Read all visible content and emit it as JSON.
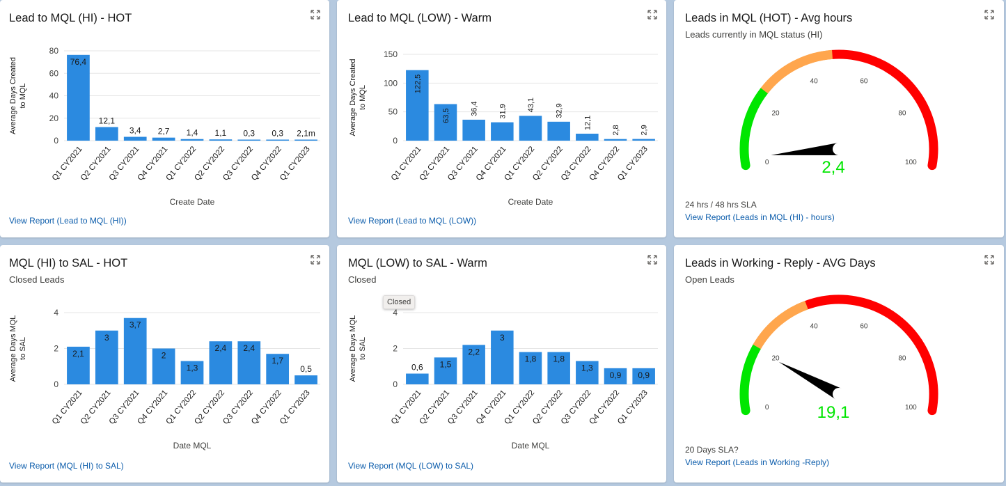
{
  "cards": {
    "c1": {
      "title": "Lead to MQL (HI) - HOT",
      "link": "View Report (Lead to MQL (HI))",
      "chart_data": {
        "type": "bar",
        "categories": [
          "Q1 CY2021",
          "Q2 CY2021",
          "Q3 CY2021",
          "Q4 CY2021",
          "Q1 CY2022",
          "Q2 CY2022",
          "Q3 CY2022",
          "Q4 CY2022",
          "Q1 CY2023"
        ],
        "values": [
          76.4,
          12.1,
          3.4,
          2.7,
          1.4,
          1.1,
          0.3,
          0.3,
          0.00146
        ],
        "labels": [
          "76,4",
          "12,1",
          "3,4",
          "2,7",
          "1,4",
          "1,1",
          "0,3",
          "0,3",
          "2,1m"
        ],
        "ylabel": "Average Days Created to MQL",
        "xlabel": "Create Date",
        "ylim": [
          0,
          80
        ],
        "yticks": [
          0,
          20,
          40,
          60,
          80
        ],
        "label_orientation": "horizontal"
      }
    },
    "c2": {
      "title": "Lead to MQL (LOW) - Warm",
      "link": "View Report (Lead to MQL (LOW))",
      "chart_data": {
        "type": "bar",
        "categories": [
          "Q1 CY2021",
          "Q2 CY2021",
          "Q3 CY2021",
          "Q4 CY2021",
          "Q1 CY2022",
          "Q2 CY2022",
          "Q3 CY2022",
          "Q4 CY2022",
          "Q1 CY2023"
        ],
        "values": [
          122.5,
          63.5,
          36.4,
          31.9,
          43.1,
          32.9,
          12.1,
          2.8,
          2.9
        ],
        "labels": [
          "122,5",
          "63,5",
          "36,4",
          "31,9",
          "43,1",
          "32,9",
          "12,1",
          "2,8",
          "2,9"
        ],
        "ylabel": "Average Days Created to MQL",
        "xlabel": "Create Date",
        "ylim": [
          0,
          150
        ],
        "yticks": [
          0,
          50,
          100,
          150
        ],
        "label_orientation": "vertical"
      }
    },
    "c3": {
      "title": "Leads in MQL (HOT) - Avg hours",
      "subtitle": "Leads currently in MQL status (HI)",
      "sla": "24 hrs / 48 hrs SLA",
      "link": "View Report (Leads in MQL (HI) - hours)",
      "gauge": {
        "min": 0,
        "max": 100,
        "value": 2.4,
        "value_label": "2,4",
        "ticks": [
          0,
          20,
          40,
          60,
          80,
          100
        ],
        "bands": [
          {
            "from": 0,
            "to": 24,
            "color": "#00e600"
          },
          {
            "from": 24,
            "to": 48,
            "color": "#ffa64d"
          },
          {
            "from": 48,
            "to": 100,
            "color": "#ff0000"
          }
        ]
      }
    },
    "c4": {
      "title": "MQL (HI) to SAL - HOT",
      "subtitle": "Closed Leads",
      "link": "View Report (MQL (HI) to SAL)",
      "chart_data": {
        "type": "bar",
        "categories": [
          "Q1 CY2021",
          "Q2 CY2021",
          "Q3 CY2021",
          "Q4 CY2021",
          "Q1 CY2022",
          "Q2 CY2022",
          "Q3 CY2022",
          "Q4 CY2022",
          "Q1 CY2023"
        ],
        "values": [
          2.1,
          3,
          3.7,
          2,
          1.3,
          2.4,
          2.4,
          1.7,
          0.5
        ],
        "labels": [
          "2,1",
          "3",
          "3,7",
          "2",
          "1,3",
          "2,4",
          "2,4",
          "1,7",
          "0,5"
        ],
        "ylabel": "Average Days MQL to SAL",
        "xlabel": "Date MQL",
        "ylim": [
          0,
          4
        ],
        "yticks": [
          0,
          2,
          4
        ],
        "label_orientation": "horizontal"
      }
    },
    "c5": {
      "title": "MQL (LOW) to SAL - Warm",
      "subtitle": "Closed",
      "tooltip": "Closed",
      "link": "View Report (MQL (LOW) to SAL)",
      "chart_data": {
        "type": "bar",
        "categories": [
          "Q1 CY2021",
          "Q2 CY2021",
          "Q3 CY2021",
          "Q4 CY2021",
          "Q1 CY2022",
          "Q2 CY2022",
          "Q3 CY2022",
          "Q4 CY2022",
          "Q1 CY2023"
        ],
        "values": [
          0.6,
          1.5,
          2.2,
          3,
          1.8,
          1.8,
          1.3,
          0.9,
          0.9
        ],
        "labels": [
          "0,6",
          "1,5",
          "2,2",
          "3",
          "1,8",
          "1,8",
          "1,3",
          "0,9",
          "0,9"
        ],
        "ylabel": "Average Days MQL to SAL",
        "xlabel": "Date MQL",
        "ylim": [
          0,
          4
        ],
        "yticks": [
          0,
          2,
          4
        ],
        "label_orientation": "horizontal"
      }
    },
    "c6": {
      "title": "Leads in Working - Reply - AVG Days",
      "subtitle": "Open Leads",
      "sla": "20 Days SLA?",
      "link": "View Report (Leads in Working -Reply)",
      "gauge": {
        "min": 0,
        "max": 100,
        "value": 19.1,
        "value_label": "19,1",
        "ticks": [
          0,
          20,
          40,
          60,
          80,
          100
        ],
        "bands": [
          {
            "from": 0,
            "to": 20,
            "color": "#00e600"
          },
          {
            "from": 20,
            "to": 40,
            "color": "#ffa64d"
          },
          {
            "from": 40,
            "to": 100,
            "color": "#ff0000"
          }
        ]
      }
    }
  },
  "colors": {
    "bar": "#2b8ae0",
    "link": "#0b5cab",
    "gauge_value": "#00e600"
  }
}
